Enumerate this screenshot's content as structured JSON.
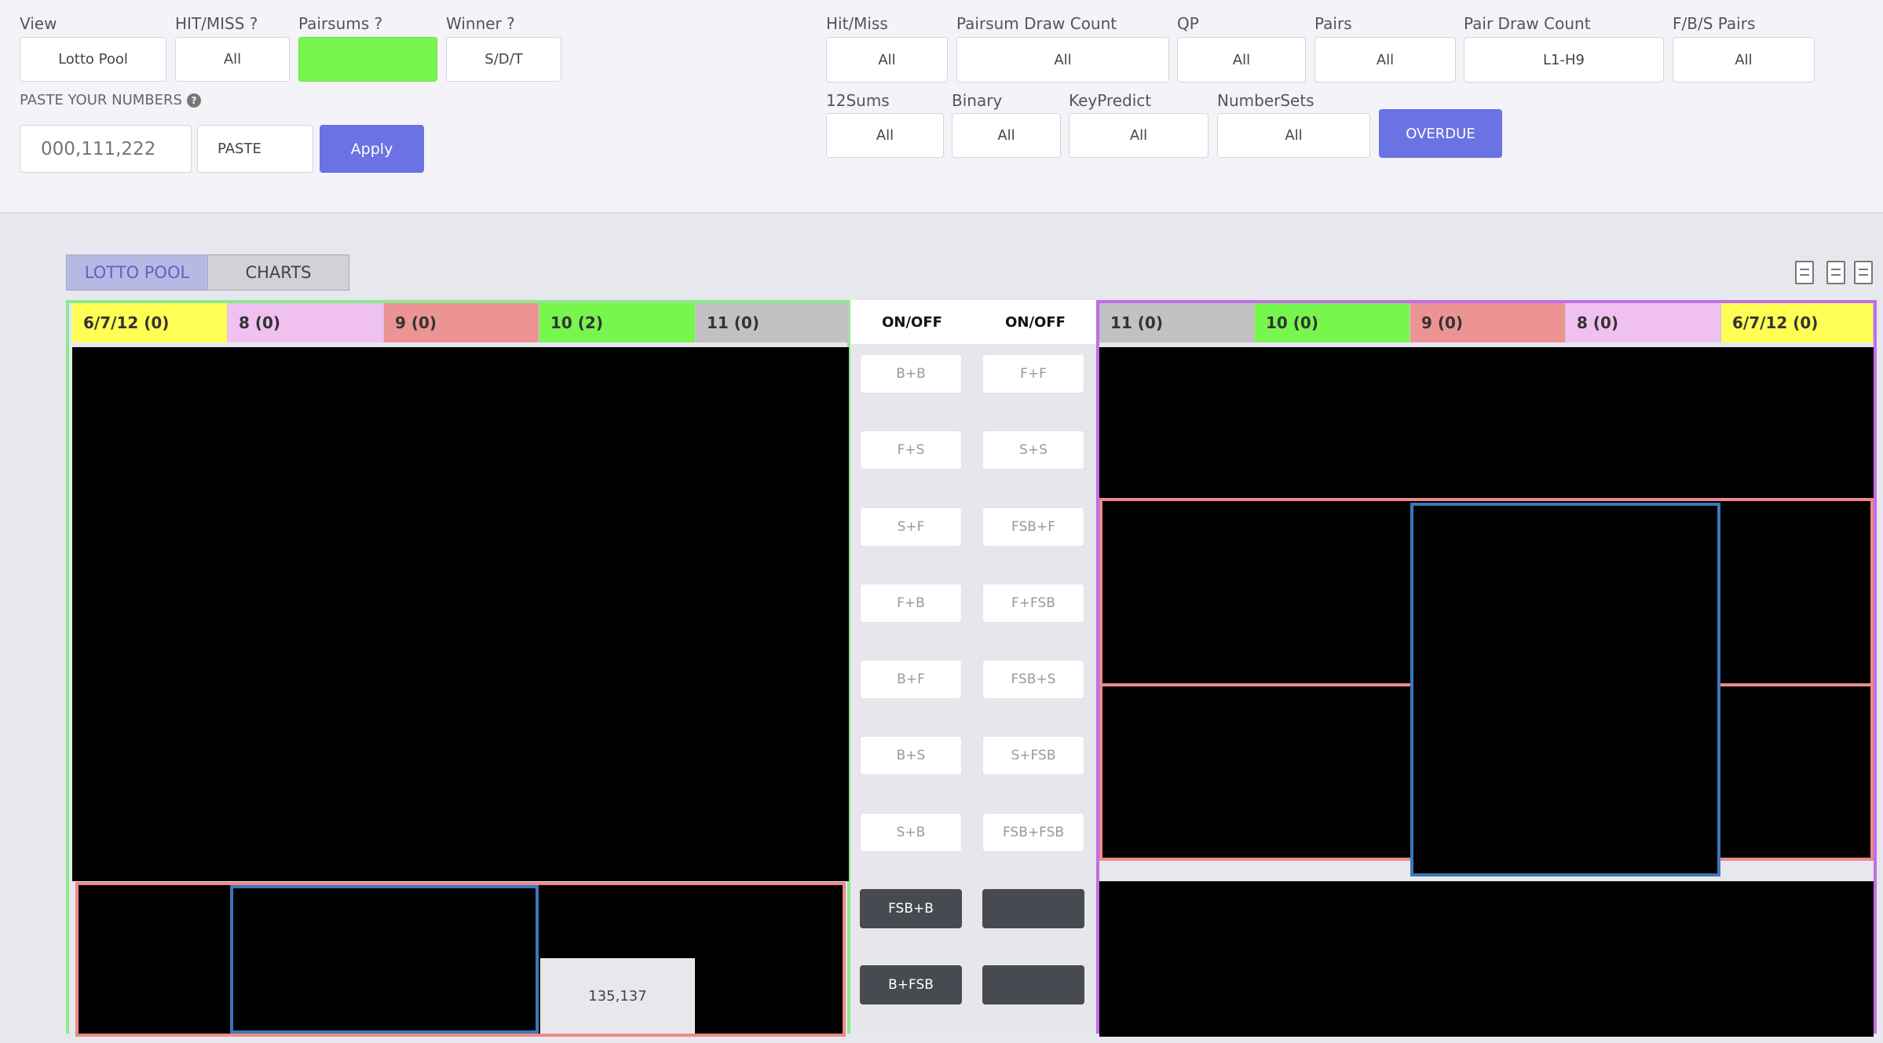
{
  "filters_left": {
    "view": {
      "label": "View",
      "value": "Lotto Pool"
    },
    "hitmiss": {
      "label": "HIT/MISS ?",
      "value": "All"
    },
    "pairsums": {
      "label": "Pairsums ?",
      "value": ""
    },
    "winner": {
      "label": "Winner ?",
      "value": "S/D/T"
    },
    "paste_label": "PASTE YOUR NUMBERS",
    "paste_placeholder": "000,111,222",
    "paste_button": "PASTE",
    "apply_button": "Apply"
  },
  "filters_right": {
    "hit_miss": {
      "label": "Hit/Miss",
      "value": "All"
    },
    "pairsum_draw_count": {
      "label": "Pairsum Draw Count",
      "value": "All"
    },
    "qp": {
      "label": "QP",
      "value": "All"
    },
    "pairs": {
      "label": "Pairs",
      "value": "All"
    },
    "pair_draw_count": {
      "label": "Pair Draw Count",
      "value": "L1-H9"
    },
    "fbs_pairs": {
      "label": "F/B/S Pairs",
      "value": "All"
    },
    "sums12": {
      "label": "12Sums",
      "value": "All"
    },
    "binary": {
      "label": "Binary",
      "value": "All"
    },
    "keypredict": {
      "label": "KeyPredict",
      "value": "All"
    },
    "numbersets": {
      "label": "NumberSets",
      "value": "All"
    },
    "overdue_button": "OVERDUE"
  },
  "tabs": {
    "lotto_pool": "LOTTO POOL",
    "charts": "CHARTS"
  },
  "left_headers": [
    "6/7/12 (0)",
    "8 (0)",
    "9 (0)",
    "10 (2)",
    "11 (0)"
  ],
  "right_headers": [
    "11 (0)",
    "10 (0)",
    "9 (0)",
    "8 (0)",
    "6/7/12 (0)"
  ],
  "header_colors": {
    "c6712": "#fefe55",
    "c8": "#f0c0f0",
    "c9": "#ec9494",
    "c10": "#77f64e",
    "c11": "#c1c1c1"
  },
  "onoff": {
    "header_left": "ON/OFF",
    "header_right": "ON/OFF",
    "left": [
      "B+B",
      "F+S",
      "S+F",
      "F+B",
      "B+F",
      "B+S",
      "S+B",
      "FSB+B",
      "B+FSB"
    ],
    "right": [
      "F+F",
      "S+S",
      "FSB+F",
      "F+FSB",
      "FSB+S",
      "S+FSB",
      "FSB+FSB",
      "",
      ""
    ]
  },
  "cell_value": "135,137"
}
